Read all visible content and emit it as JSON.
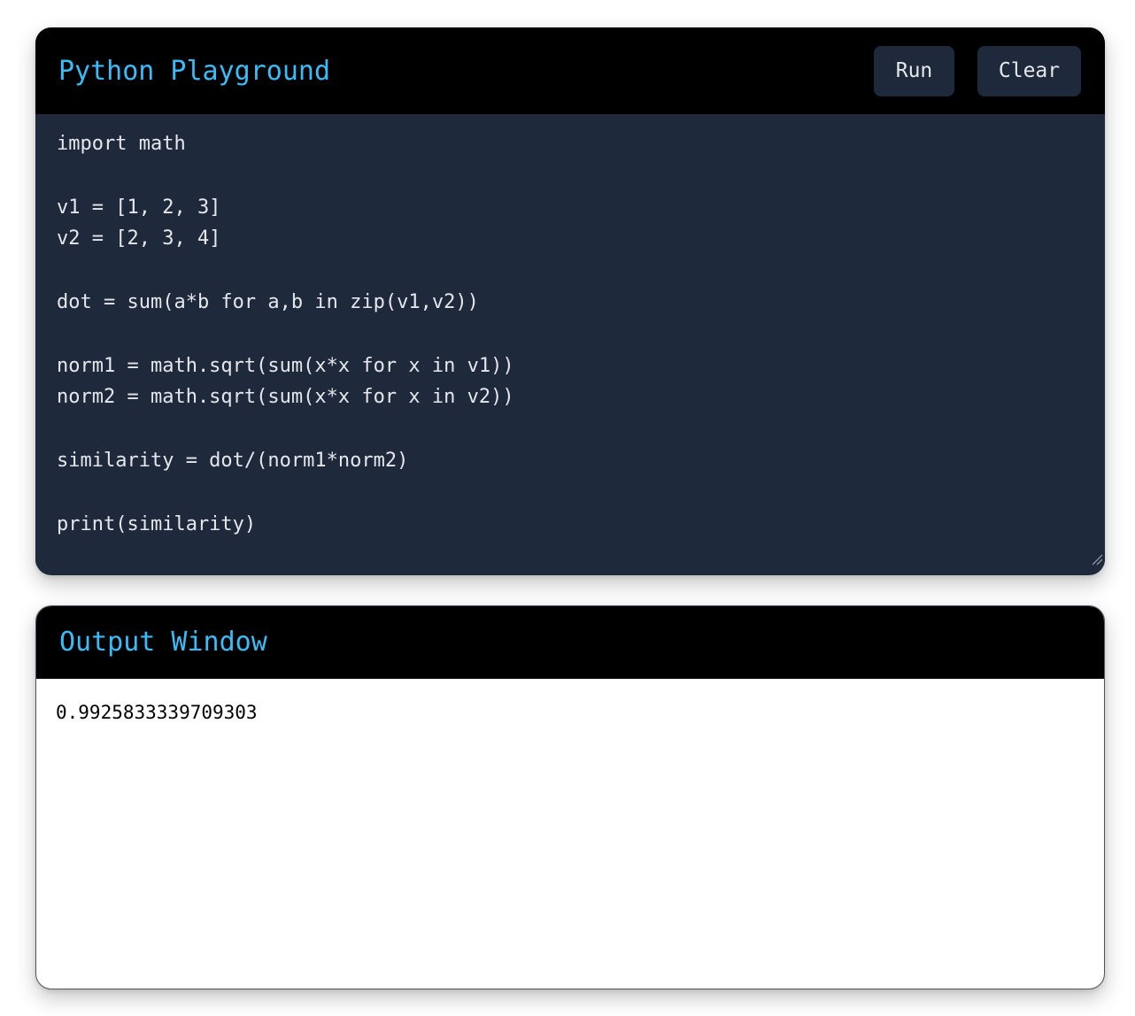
{
  "editor": {
    "title": "Python Playground",
    "run_label": "Run",
    "clear_label": "Clear",
    "code": "import math\n\nv1 = [1, 2, 3]\nv2 = [2, 3, 4]\n\ndot = sum(a*b for a,b in zip(v1,v2))\n\nnorm1 = math.sqrt(sum(x*x for x in v1))\nnorm2 = math.sqrt(sum(x*x for x in v2))\n\nsimilarity = dot/(norm1*norm2)\n\nprint(similarity)"
  },
  "output": {
    "title": "Output Window",
    "text": "0.9925833339709303"
  },
  "colors": {
    "accent": "#38bdf8",
    "header_bg": "#000000",
    "editor_bg": "#1e293b",
    "button_bg": "#1e293b",
    "text_light": "#e5e7eb"
  },
  "icons": {
    "resize": "resize-grip-icon"
  }
}
